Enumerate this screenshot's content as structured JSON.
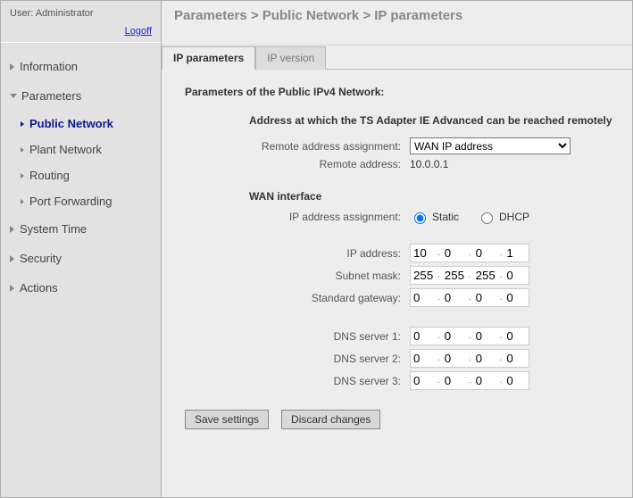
{
  "user": {
    "label": "User: Administrator",
    "logoff": "Logoff"
  },
  "breadcrumb": "Parameters > Public Network > IP parameters",
  "nav": {
    "information": "Information",
    "parameters": "Parameters",
    "public_network": "Public Network",
    "plant_network": "Plant Network",
    "routing": "Routing",
    "port_forwarding": "Port Forwarding",
    "system_time": "System Time",
    "security": "Security",
    "actions": "Actions"
  },
  "tabs": {
    "ip_parameters": "IP parameters",
    "ip_version": "IP version"
  },
  "content": {
    "section_title": "Parameters of the Public IPv4 Network:",
    "remote_title": "Address at which the TS Adapter IE Advanced can be reached remotely",
    "remote_assign_label": "Remote address assignment:",
    "remote_assign_value": "WAN IP address",
    "remote_addr_label": "Remote address:",
    "remote_addr_value": "10.0.0.1",
    "wan_title": "WAN interface",
    "ip_assign_label": "IP address assignment:",
    "ip_assign_static": "Static",
    "ip_assign_dhcp": "DHCP",
    "ip_addr_label": "IP address:",
    "ip_addr": [
      "10",
      "0",
      "0",
      "1"
    ],
    "subnet_label": "Subnet mask:",
    "subnet": [
      "255",
      "255",
      "255",
      "0"
    ],
    "gateway_label": "Standard gateway:",
    "gateway": [
      "0",
      "0",
      "0",
      "0"
    ],
    "dns1_label": "DNS server 1:",
    "dns1": [
      "0",
      "0",
      "0",
      "0"
    ],
    "dns2_label": "DNS server 2:",
    "dns2": [
      "0",
      "0",
      "0",
      "0"
    ],
    "dns3_label": "DNS server 3:",
    "dns3": [
      "0",
      "0",
      "0",
      "0"
    ],
    "save": "Save settings",
    "discard": "Discard changes"
  }
}
